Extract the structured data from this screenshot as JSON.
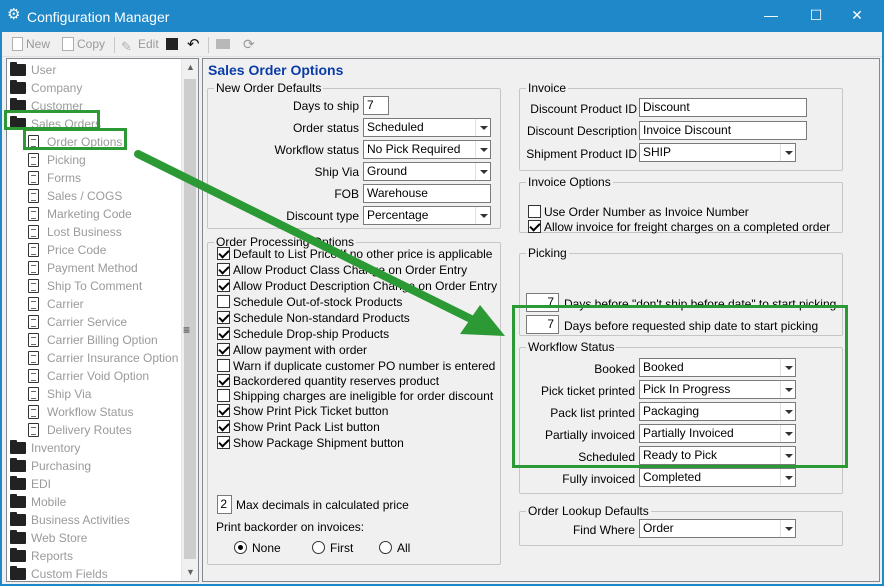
{
  "window": {
    "title": "Configuration Manager",
    "minimize": "—",
    "maximize": "☐",
    "close": "✕"
  },
  "toolbar": {
    "new_label": "New",
    "copy_label": "Copy",
    "edit_label": "Edit"
  },
  "tree": {
    "items": [
      {
        "label": "User",
        "type": "folder"
      },
      {
        "label": "Company",
        "type": "folder"
      },
      {
        "label": "Customer",
        "type": "folder"
      },
      {
        "label": "Sales Orders",
        "type": "folder-open"
      },
      {
        "label": "Order Options",
        "type": "doc"
      },
      {
        "label": "Picking",
        "type": "doc"
      },
      {
        "label": "Forms",
        "type": "doc"
      },
      {
        "label": "Sales / COGS",
        "type": "doc"
      },
      {
        "label": "Marketing Code",
        "type": "doc"
      },
      {
        "label": "Lost Business",
        "type": "doc"
      },
      {
        "label": "Price Code",
        "type": "doc"
      },
      {
        "label": "Payment Method",
        "type": "doc"
      },
      {
        "label": "Ship To Comment",
        "type": "doc"
      },
      {
        "label": "Carrier",
        "type": "doc"
      },
      {
        "label": "Carrier Service",
        "type": "doc"
      },
      {
        "label": "Carrier Billing Option",
        "type": "doc"
      },
      {
        "label": "Carrier Insurance Option",
        "type": "doc"
      },
      {
        "label": "Carrier Void Option",
        "type": "doc"
      },
      {
        "label": "Ship Via",
        "type": "doc"
      },
      {
        "label": "Workflow Status",
        "type": "doc"
      },
      {
        "label": "Delivery Routes",
        "type": "doc"
      },
      {
        "label": "Inventory",
        "type": "folder"
      },
      {
        "label": "Purchasing",
        "type": "folder"
      },
      {
        "label": "EDI",
        "type": "folder"
      },
      {
        "label": "Mobile",
        "type": "folder"
      },
      {
        "label": "Business Activities",
        "type": "folder"
      },
      {
        "label": "Web Store",
        "type": "folder"
      },
      {
        "label": "Reports",
        "type": "folder"
      },
      {
        "label": "Custom Fields",
        "type": "folder"
      }
    ]
  },
  "panel": {
    "title": "Sales Order Options",
    "new_order_defaults": {
      "legend": "New Order Defaults",
      "days_to_ship_label": "Days to ship",
      "days_to_ship": "7",
      "order_status_label": "Order status",
      "order_status": "Scheduled",
      "workflow_status_label": "Workflow status",
      "workflow_status": "No Pick Required",
      "ship_via_label": "Ship Via",
      "ship_via": "Ground",
      "fob_label": "FOB",
      "fob": "Warehouse",
      "discount_type_label": "Discount type",
      "discount_type": "Percentage"
    },
    "order_processing": {
      "legend": "Order Processing Options",
      "options": [
        {
          "label": "Default to List Price if no other price is applicable",
          "checked": true
        },
        {
          "label": "Allow Product Class Change on Order Entry",
          "checked": true
        },
        {
          "label": "Allow Product Description Change on Order Entry",
          "checked": true
        },
        {
          "label": "Schedule Out-of-stock Products",
          "checked": false
        },
        {
          "label": "Schedule Non-standard Products",
          "checked": true
        },
        {
          "label": "Schedule Drop-ship Products",
          "checked": true
        },
        {
          "label": "Allow payment with order",
          "checked": true
        },
        {
          "label": "Warn if duplicate customer PO number is entered",
          "checked": false
        },
        {
          "label": "Backordered quantity reserves product",
          "checked": true
        },
        {
          "label": "Shipping charges are ineligible for order discount",
          "checked": false
        },
        {
          "label": "Show Print Pick Ticket button",
          "checked": true
        },
        {
          "label": "Show Print Pack List button",
          "checked": true
        },
        {
          "label": "Show Package Shipment button",
          "checked": true
        }
      ],
      "max_decimals": "2",
      "max_decimals_label": "Max decimals in calculated price",
      "print_backorder_label": "Print backorder on invoices:",
      "radio_none": "None",
      "radio_first": "First",
      "radio_all": "All",
      "radio_selected": "None"
    },
    "invoice": {
      "legend": "Invoice",
      "discount_product_id_label": "Discount Product ID",
      "discount_product_id": "Discount",
      "discount_description_label": "Discount Description",
      "discount_description": "Invoice Discount",
      "shipment_product_id_label": "Shipment Product ID",
      "shipment_product_id": "SHIP"
    },
    "invoice_options": {
      "legend": "Invoice Options",
      "use_order_number": {
        "label": "Use Order Number as Invoice Number",
        "checked": false
      },
      "allow_freight": {
        "label": "Allow invoice for freight charges on a completed order",
        "checked": true
      }
    },
    "picking": {
      "legend": "Picking",
      "days1": "7",
      "days1_label": "Days before \"don't ship before date\" to start picking",
      "days2": "7",
      "days2_label": "Days before requested ship date to start picking"
    },
    "workflow_status": {
      "legend": "Workflow Status",
      "rows": [
        {
          "label": "Booked",
          "value": "Booked"
        },
        {
          "label": "Pick ticket printed",
          "value": "Pick In Progress"
        },
        {
          "label": "Pack list printed",
          "value": "Packaging"
        },
        {
          "label": "Partially invoiced",
          "value": "Partially Invoiced"
        },
        {
          "label": "Scheduled",
          "value": "Ready to Pick"
        },
        {
          "label": "Fully invoiced",
          "value": "Completed"
        }
      ]
    },
    "order_lookup": {
      "legend": "Order Lookup Defaults",
      "find_where_label": "Find Where",
      "find_where": "Order"
    }
  },
  "colors": {
    "title_bar": "#1e88c8",
    "highlight": "#2b9a34",
    "panel_title": "#0a3ca8"
  }
}
